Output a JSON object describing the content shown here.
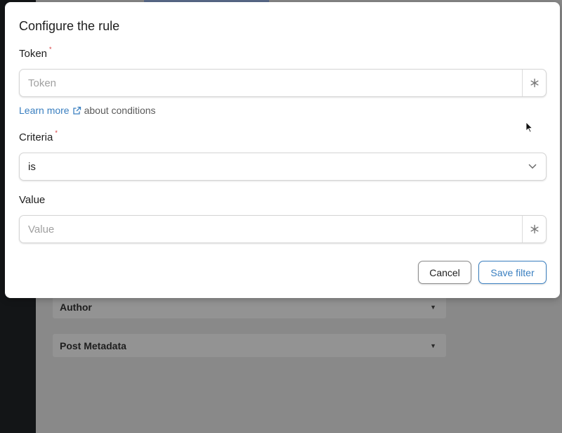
{
  "background": {
    "panels": [
      {
        "label": "Author"
      },
      {
        "label": "Post Metadata"
      }
    ]
  },
  "dialog": {
    "title": "Configure the rule",
    "token": {
      "label": "Token",
      "required_mark": "*",
      "placeholder": "Token",
      "addon_icon": "asterisk-icon"
    },
    "learn_more": {
      "link_text": "Learn more",
      "suffix": "about conditions",
      "icon": "external-link-icon"
    },
    "criteria": {
      "label": "Criteria",
      "required_mark": "*",
      "value": "is",
      "icon": "chevron-down-icon"
    },
    "value_field": {
      "label": "Value",
      "placeholder": "Value",
      "addon_icon": "asterisk-icon"
    },
    "buttons": {
      "cancel": "Cancel",
      "save": "Save filter"
    }
  },
  "colors": {
    "accent": "#3a7fc0",
    "required": "#d63638",
    "overlay": "#898989",
    "rail": "#131517"
  }
}
